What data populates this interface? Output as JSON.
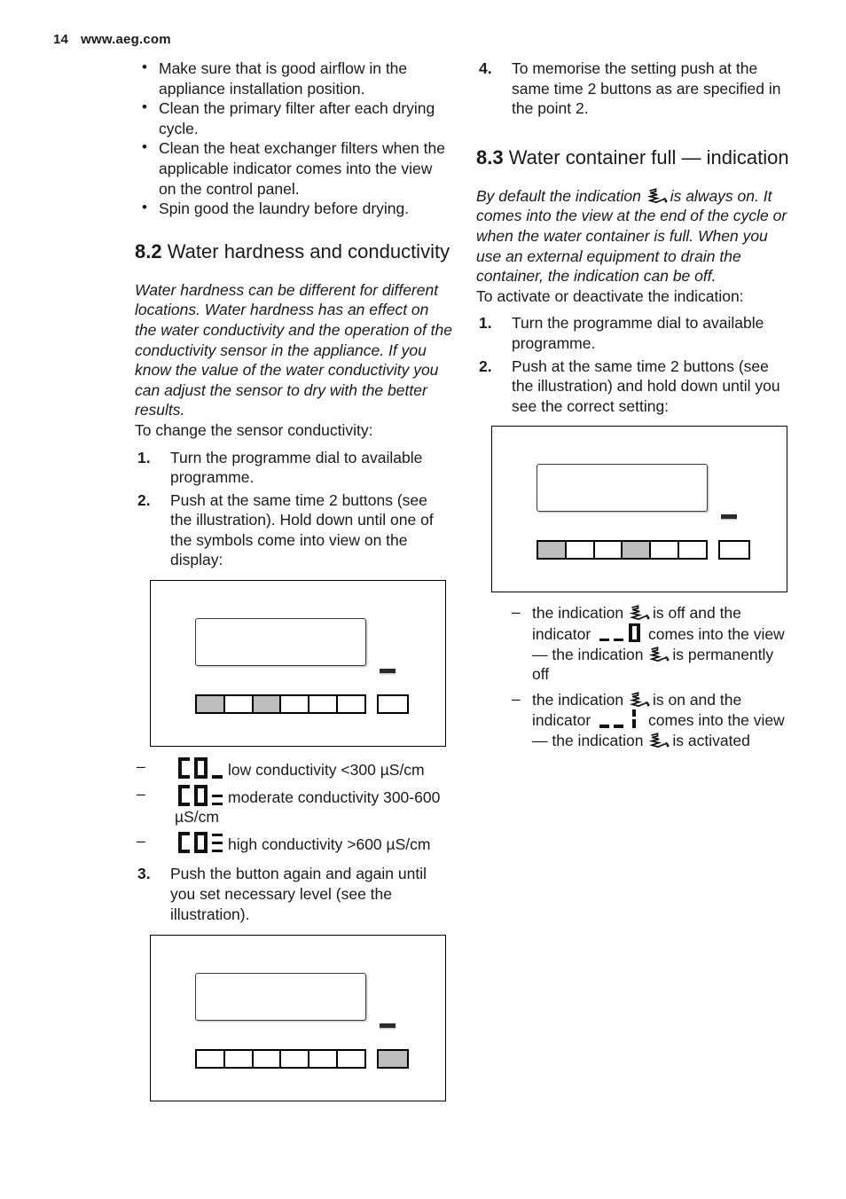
{
  "header": {
    "page_number": "14",
    "site": "www.aeg.com"
  },
  "left_column": {
    "tips": [
      "Make sure that is good airflow in the appliance installation position.",
      "Clean the primary filter after each drying cycle.",
      "Clean the heat exchanger filters when the applicable indicator comes into the view on the control panel.",
      "Spin good the laundry before drying."
    ],
    "section": {
      "number": "8.2",
      "title": "Water hardness and conductivity"
    },
    "intro_italic": "Water hardness can be different for different locations. Water hardness has an effect on the water conductivity and the operation of the conductivity sensor in the appliance. If you know the value of the water conductivity you can adjust the sensor to dry with the better results.",
    "lead_in": "To change the sensor conductivity:",
    "steps": [
      {
        "marker": "1.",
        "text": "Turn the programme dial to available programme."
      },
      {
        "marker": "2.",
        "text": "Push at the same time 2 buttons (see the illustration). Hold down until one of the symbols come into view on the display:"
      }
    ],
    "illustration_1": {
      "name": "control-panel-buttons-1-and-3-pressed",
      "keys": [
        true,
        false,
        true,
        false,
        false,
        false
      ],
      "single_key": false
    },
    "conductivity_levels": [
      {
        "symbol": "C0_",
        "bars": 1,
        "text": "low conductivity <300 µS/cm"
      },
      {
        "symbol": "C0=",
        "bars": 2,
        "text": "moderate conductivity 300-600 µS/cm"
      },
      {
        "symbol": "C0≡",
        "bars": 3,
        "text": "high conductivity >600 µS/cm"
      }
    ],
    "step_3": {
      "marker": "3.",
      "text": "Push the button again and again until you set necessary level (see the illustration)."
    },
    "illustration_2": {
      "name": "control-panel-single-button-pressed",
      "keys": [
        false,
        false,
        false,
        false,
        false,
        false
      ],
      "single_key": true
    }
  },
  "right_column": {
    "step_4": {
      "marker": "4.",
      "text": "To memorise the setting push at the same time 2 buttons as are specified in the point 2."
    },
    "section": {
      "number": "8.3",
      "title": "Water container full — indication"
    },
    "intro_italic_part1": "By default the indication",
    "intro_italic_part2": "is always on. It comes into the view at the end of the cycle or when the water container is full. When you use an external equipment to drain the container, the indication can be off.",
    "lead_in": "To activate or deactivate the indication:",
    "steps": [
      {
        "marker": "1.",
        "text": "Turn the programme dial to available programme."
      },
      {
        "marker": "2.",
        "text": "Push at the same time 2 buttons (see the illustration) and hold down until you see the correct setting:"
      }
    ],
    "illustration_3": {
      "name": "control-panel-buttons-1-and-4-pressed",
      "keys": [
        true,
        false,
        false,
        true,
        false,
        false
      ],
      "single_key": false
    },
    "outcomes": [
      {
        "indicator_symbol": "_ _ 0",
        "part1": "the indication",
        "part2": "is off and the indicator",
        "part3": "comes into the view — the indication",
        "part4": "is permanently off"
      },
      {
        "indicator_symbol": "_ _ |",
        "part1": "the indication",
        "part2": "is on and the indicator",
        "part3": "comes into the view — the indication",
        "part4": "is activated"
      }
    ]
  },
  "colors": {
    "text": "#1a1a1a",
    "key_active": "#bdbdbd",
    "panel_border": "#000000",
    "led": "#2b2b2b"
  }
}
